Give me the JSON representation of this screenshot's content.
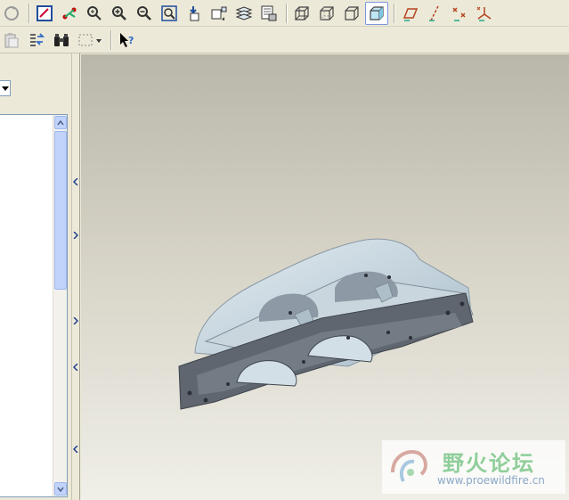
{
  "toolbar_top": {
    "items": [
      {
        "name": "regenerate-icon"
      },
      {
        "name": "datum-display-icon"
      },
      {
        "name": "spin-center-icon"
      },
      {
        "name": "orient-mode-icon"
      },
      {
        "name": "zoom-in-icon"
      },
      {
        "name": "zoom-out-icon"
      },
      {
        "name": "refit-icon"
      },
      {
        "name": "reorient-icon"
      },
      {
        "name": "saved-views-icon"
      },
      {
        "name": "layers-icon"
      },
      {
        "name": "view-manager-icon"
      },
      {
        "name": "wireframe-icon"
      },
      {
        "name": "hidden-line-icon"
      },
      {
        "name": "no-hidden-icon"
      },
      {
        "name": "shading-icon"
      },
      {
        "name": "datum-plane-icon"
      },
      {
        "name": "datum-axis-icon"
      },
      {
        "name": "datum-point-icon"
      },
      {
        "name": "coordinate-system-icon"
      }
    ]
  },
  "toolbar_second": {
    "items": [
      {
        "name": "paste-icon"
      },
      {
        "name": "find-icon"
      },
      {
        "name": "binoculars-icon"
      },
      {
        "name": "selection-box-icon"
      },
      {
        "name": "context-help-icon"
      }
    ]
  },
  "watermark": {
    "title": "野火论坛",
    "url": "www.proewildfire.cn"
  },
  "colors": {
    "part_light": "#c5d3dc",
    "part_dark": "#5f6670",
    "accent": "#316ac5"
  }
}
